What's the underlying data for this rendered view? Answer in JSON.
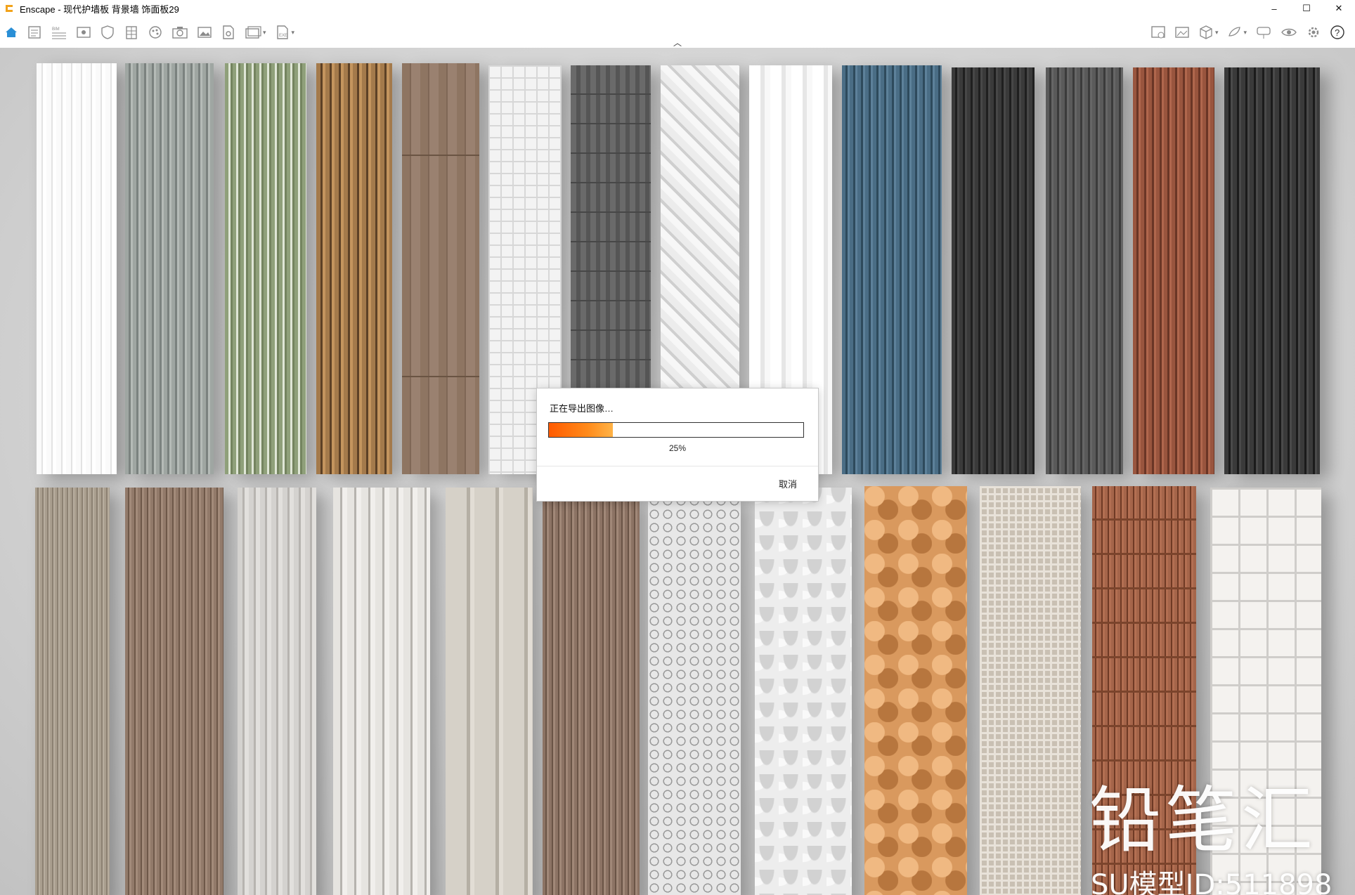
{
  "window": {
    "title": "Enscape - 现代护墙板 背景墙 饰面板29",
    "controls": {
      "minimize": "–",
      "maximize": "☐",
      "close": "✕"
    }
  },
  "toolbar": {
    "left_icons": [
      "home-icon",
      "document-icon",
      "bim-icon",
      "view-icon",
      "shield-icon",
      "building-icon",
      "material-icon",
      "camera-icon",
      "image-icon",
      "settings-doc-icon",
      "batch-render-icon",
      "export-icon"
    ],
    "right_icons": [
      "image-export-icon",
      "panorama-icon",
      "cube-icon",
      "vr-icon",
      "collaborate-icon",
      "visibility-icon",
      "settings-icon",
      "help-icon"
    ]
  },
  "dialog": {
    "title": "正在导出图像…",
    "progress": 0.25,
    "progress_label": "25%",
    "cancel_label": "取消"
  },
  "watermark": {
    "brand": "铅笔汇",
    "model_id": "SU模型ID:511898"
  },
  "colors": {
    "progress_start": "#ff5b00",
    "progress_end": "#ffb347",
    "accent": "#2a8fd6"
  }
}
